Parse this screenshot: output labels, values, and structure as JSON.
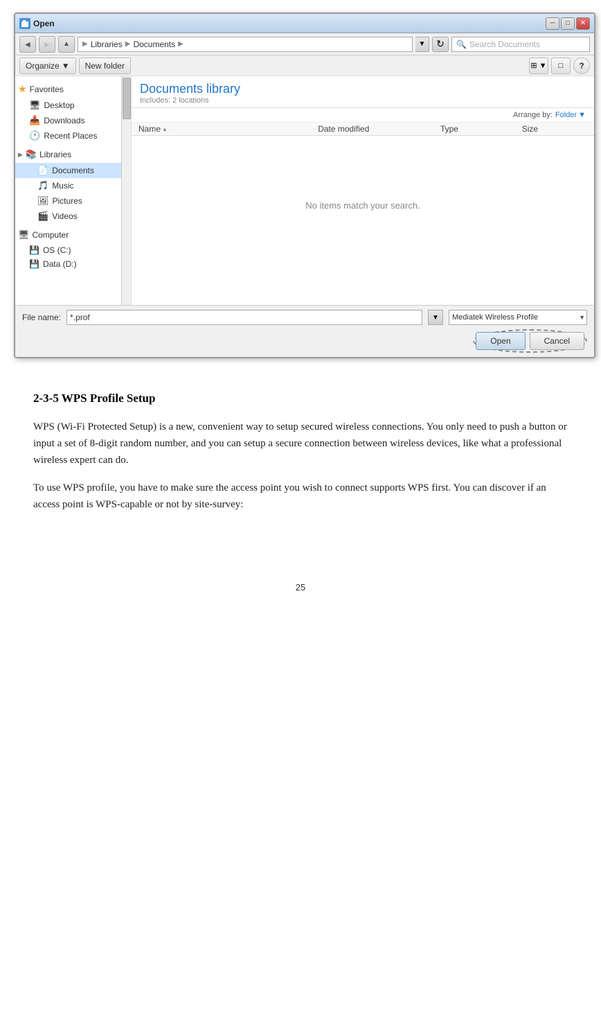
{
  "window": {
    "title": "Open",
    "title_icon": "📄",
    "close_btn": "✕",
    "min_btn": "─",
    "max_btn": "□"
  },
  "address_bar": {
    "path_parts": [
      "Libraries",
      "Documents"
    ],
    "search_placeholder": "Search Documents",
    "refresh_symbol": "↺"
  },
  "toolbar": {
    "organize_label": "Organize",
    "new_folder_label": "New folder",
    "views_icon": "≡",
    "window_icon": "□",
    "help_icon": "?"
  },
  "sidebar": {
    "favorites_label": "Favorites",
    "desktop_label": "Desktop",
    "downloads_label": "Downloads",
    "recent_places_label": "Recent Places",
    "libraries_label": "Libraries",
    "documents_label": "Documents",
    "music_label": "Music",
    "pictures_label": "Pictures",
    "videos_label": "Videos",
    "computer_label": "Computer",
    "os_c_label": "OS (C:)",
    "data_d_label": "Data (D:)"
  },
  "content": {
    "library_title": "Documents library",
    "library_subtitle": "Includes:  2 locations",
    "arrange_label": "Arrange by:",
    "arrange_value": "Folder",
    "col_name": "Name",
    "col_date": "Date modified",
    "col_type": "Type",
    "col_size": "Size",
    "empty_message": "No items match your search."
  },
  "bottom_bar": {
    "filename_label": "File name:",
    "filename_value": "*.prof",
    "filetype_value": "Mediatek Wireless Profile",
    "open_label": "Open",
    "cancel_label": "Cancel"
  },
  "doc": {
    "section_heading": "2-3-5 WPS Profile Setup",
    "paragraph1": "WPS (Wi-Fi Protected Setup) is a new, convenient way to setup secured wireless connections. You only need to push a button or input a set of 8-digit random number, and you can setup a secure connection between wireless devices, like what a professional wireless expert can do.",
    "paragraph2": "To use WPS profile, you have to make sure the access point you wish to connect supports WPS first. You can discover if an access point is WPS-capable or not by site-survey:",
    "page_number": "25"
  }
}
